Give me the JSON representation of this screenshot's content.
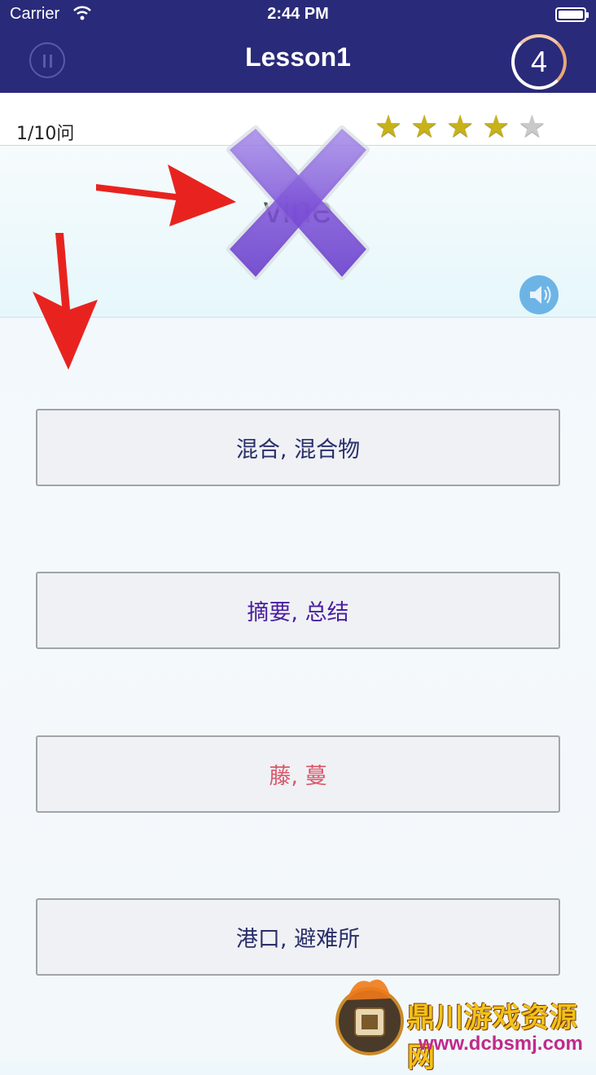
{
  "status_bar": {
    "carrier": "Carrier",
    "time": "2:44 PM"
  },
  "nav": {
    "title": "Lesson1",
    "counter": "4"
  },
  "progress": {
    "text": "1/10问",
    "stars_filled": 4,
    "stars_total": 5
  },
  "question": {
    "word": "vine",
    "result": "wrong"
  },
  "options": [
    {
      "label": "混合, 混合物"
    },
    {
      "label": "摘要, 总结"
    },
    {
      "label": "藤, 蔓"
    },
    {
      "label": "港口, 避难所"
    }
  ],
  "colors": {
    "navbar": "#2a2a7a",
    "wrong_mark": "#7b4fd6",
    "speaker": "#6db4e6",
    "option_correct": "#d9576a",
    "annotation_arrow": "#e8231f"
  },
  "watermark": {
    "name": "鼎川游戏资源网",
    "url": "www.dcbsmj.com"
  }
}
